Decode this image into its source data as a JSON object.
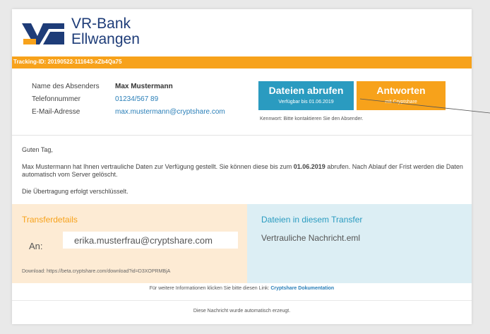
{
  "bank": {
    "name_line1": "VR-Bank",
    "name_line2": "Ellwangen",
    "brand_blue": "#1e3c78",
    "brand_orange": "#f7a21b",
    "accent_blue": "#2a9bc0"
  },
  "tracking": {
    "text": "Tracking-ID: 20190522-111643-xZb4Qa75"
  },
  "sender": {
    "name_label": "Name des Absenders",
    "name_value": "Max Mustermann",
    "phone_label": "Telefonnummer",
    "phone_value": "01234/567 89",
    "email_label": "E-Mail-Adresse",
    "email_value": "max.mustermann@cryptshare.com"
  },
  "actions": {
    "fetch_label": "Dateien abrufen",
    "fetch_sub": "Verfügbar bis 01.06.2019",
    "reply_label": "Antworten",
    "reply_sub": "mit Cryptshare",
    "password_note": "Kennwort: Bitte kontaktieren Sie den Absender."
  },
  "message": {
    "greeting": "Guten Tag,",
    "body_part1": "Max Mustermann hat Ihnen vertrauliche Daten zur Verfügung gestellt. Sie können diese bis zum ",
    "body_date": "01.06.2019",
    "body_part2": " abrufen. Nach Ablauf der Frist werden die Daten automatisch vom Server gelöscht.",
    "encryption": "Die Übertragung erfolgt verschlüsselt."
  },
  "transfer": {
    "title": "Transferdetails",
    "to_label": "An:",
    "recipient": "erika.musterfrau@cryptshare.com",
    "download": "Download: https://beta.cryptshare.com/download?id=D3XOPRMBjA"
  },
  "files": {
    "title": "Dateien in diesem Transfer",
    "items": [
      "Vertrauliche Nachricht.eml"
    ]
  },
  "footer": {
    "info_text": "Für weitere Informationen klicken Sie bitte diesen Link: ",
    "info_link": "Cryptshare Dokumentation",
    "auto_note": "Diese Nachricht wurde automatisch erzeugt."
  }
}
